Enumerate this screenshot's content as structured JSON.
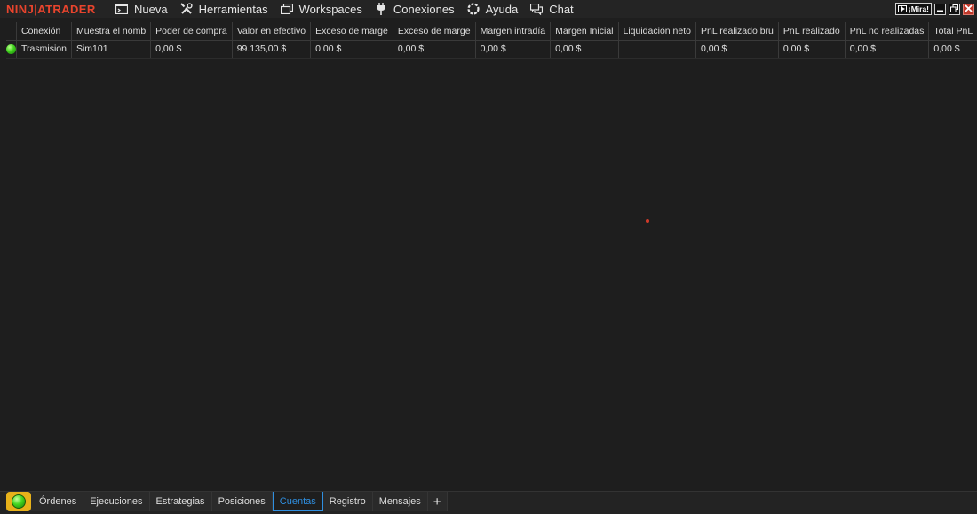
{
  "app": {
    "logo_left": "NINJ",
    "logo_right": "ATRADER",
    "menu": [
      {
        "label": "Nueva",
        "icon": "new-window-icon"
      },
      {
        "label": "Herramientas",
        "icon": "tools-icon"
      },
      {
        "label": "Workspaces",
        "icon": "workspaces-icon"
      },
      {
        "label": "Conexiones",
        "icon": "plug-icon"
      },
      {
        "label": "Ayuda",
        "icon": "help-icon"
      },
      {
        "label": "Chat",
        "icon": "chat-icon"
      }
    ],
    "window_controls": {
      "mira_label": "¡Mira!",
      "minimize": "minimize-icon",
      "restore": "restore-icon",
      "close": "close-icon"
    }
  },
  "grid": {
    "columns": [
      "",
      "Conexión",
      "Muestra el nomb",
      "Poder de compra",
      "Valor en efectivo",
      "Exceso de marge",
      "Exceso de marge",
      "Margen intradía",
      "Margen Inicial",
      "Liquidación neto",
      "PnL realizado bru",
      "PnL realizado",
      "PnL no realizadas",
      "Total PnL"
    ],
    "rows": [
      {
        "status": "connected",
        "cells": [
          "Trasmision",
          "Sim101",
          "0,00 $",
          "99.135,00 $",
          "0,00 $",
          "0,00 $",
          "0,00 $",
          "0,00 $",
          "",
          "0,00 $",
          "0,00 $",
          "0,00 $",
          "0,00 $"
        ]
      }
    ]
  },
  "tabs": {
    "items": [
      "Órdenes",
      "Ejecuciones",
      "Estrategias",
      "Posiciones",
      "Cuentas",
      "Registro",
      "Mensajes"
    ],
    "active": "Cuentas",
    "add_label": "+"
  },
  "colors": {
    "brand": "#e8442d",
    "active_tab": "#2f8fe0",
    "status_button": "#e8b21a",
    "connected": "#3fd11d"
  }
}
